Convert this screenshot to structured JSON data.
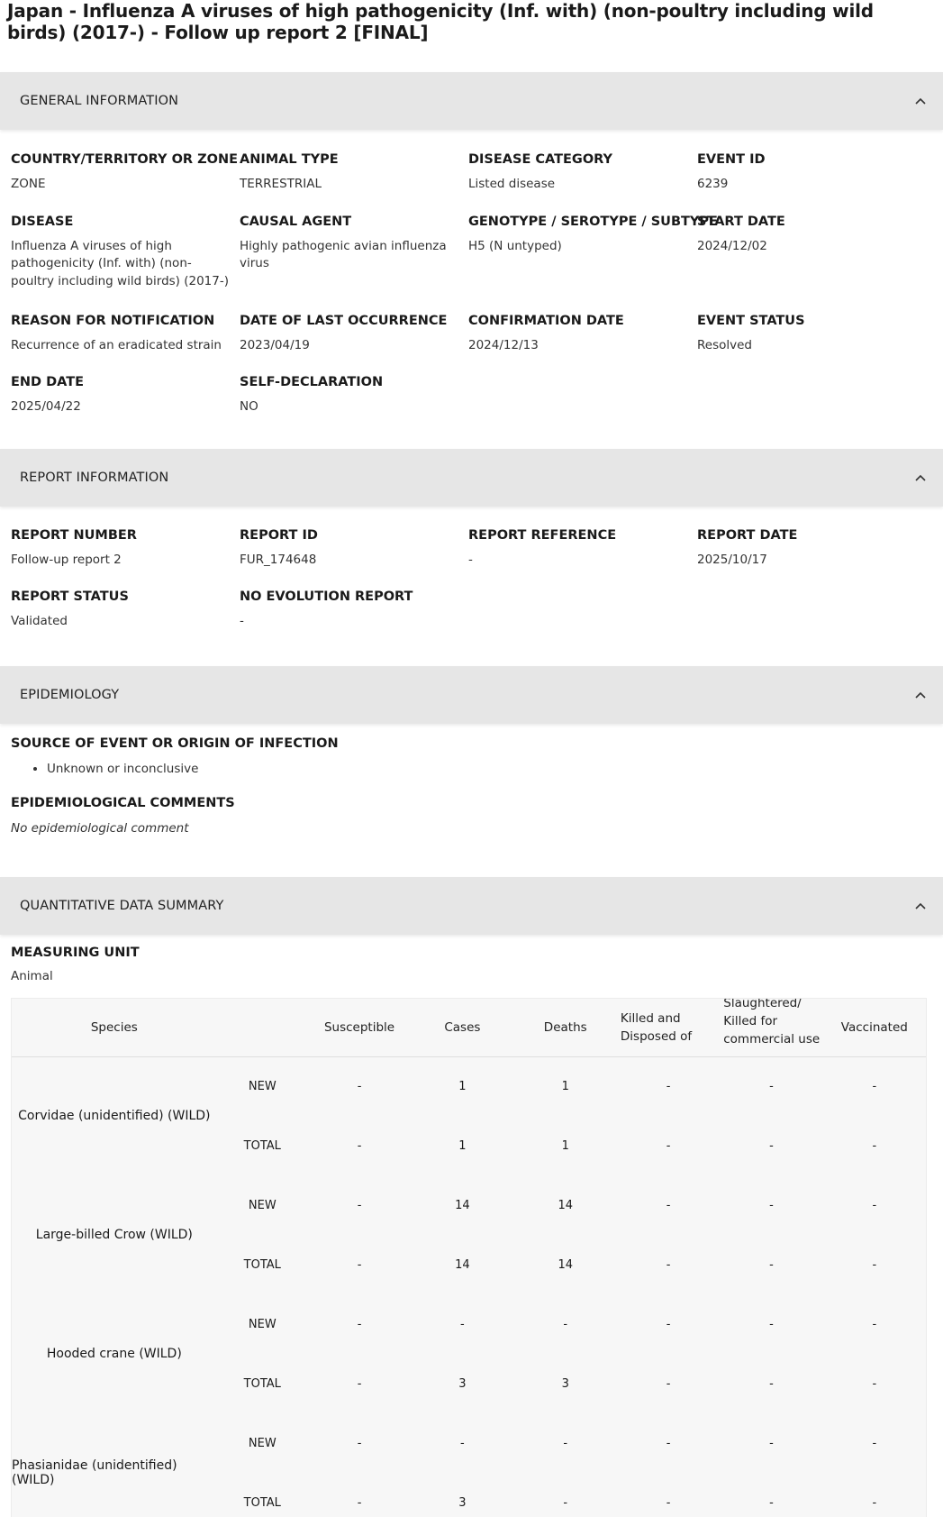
{
  "title": "Japan - Influenza A viruses of high pathogenicity (Inf. with) (non-poultry including wild birds) (2017-) - Follow up report 2 [FINAL]",
  "sections": {
    "general": {
      "label": "GENERAL INFORMATION"
    },
    "report": {
      "label": "REPORT INFORMATION"
    },
    "epi": {
      "label": "EPIDEMIOLOGY"
    },
    "quant": {
      "label": "QUANTITATIVE DATA SUMMARY"
    }
  },
  "general": {
    "country": {
      "k": "COUNTRY/TERRITORY OR ZONE",
      "v": "ZONE"
    },
    "animal_type": {
      "k": "ANIMAL TYPE",
      "v": "TERRESTRIAL"
    },
    "disease_category": {
      "k": "DISEASE CATEGORY",
      "v": "Listed disease"
    },
    "event_id": {
      "k": "EVENT ID",
      "v": "6239"
    },
    "disease": {
      "k": "DISEASE",
      "v": "Influenza A viruses of high pathogenicity (Inf. with) (non-poultry including wild birds) (2017-)"
    },
    "causal_agent": {
      "k": "CAUSAL AGENT",
      "v": "Highly pathogenic avian influenza virus"
    },
    "genotype": {
      "k": "GENOTYPE / SEROTYPE / SUBTYPE",
      "v": "H5 (N untyped)"
    },
    "start_date": {
      "k": "START DATE",
      "v": "2024/12/02"
    },
    "reason": {
      "k": "REASON FOR NOTIFICATION",
      "v": "Recurrence of an eradicated strain"
    },
    "last_occurrence": {
      "k": "DATE OF LAST OCCURRENCE",
      "v": "2023/04/19"
    },
    "confirmation": {
      "k": "CONFIRMATION DATE",
      "v": "2024/12/13"
    },
    "event_status": {
      "k": "EVENT STATUS",
      "v": "Resolved"
    },
    "end_date": {
      "k": "END DATE",
      "v": "2025/04/22"
    },
    "self_declaration": {
      "k": "SELF-DECLARATION",
      "v": "NO"
    }
  },
  "report": {
    "number": {
      "k": "REPORT NUMBER",
      "v": "Follow-up report 2"
    },
    "id": {
      "k": "REPORT ID",
      "v": "FUR_174648"
    },
    "reference": {
      "k": "REPORT REFERENCE",
      "v": "-"
    },
    "date": {
      "k": "REPORT DATE",
      "v": "2025/10/17"
    },
    "status": {
      "k": "REPORT STATUS",
      "v": "Validated"
    },
    "no_evolution": {
      "k": "NO EVOLUTION REPORT",
      "v": "-"
    }
  },
  "epi": {
    "source": {
      "k": "SOURCE OF EVENT OR ORIGIN OF INFECTION",
      "items": [
        "Unknown or inconclusive"
      ]
    },
    "comments": {
      "k": "EPIDEMIOLOGICAL COMMENTS",
      "v": "No epidemiological comment"
    }
  },
  "quant": {
    "measuring_unit": {
      "k": "MEASURING UNIT",
      "v": "Animal"
    },
    "columns": [
      "Species",
      "",
      "Susceptible",
      "Cases",
      "Deaths",
      "Killed and Disposed of",
      "Slaughtered/ Killed for commercial use",
      "Vaccinated"
    ],
    "rows": [
      {
        "species": "Corvidae (unidentified) (WILD)",
        "new": [
          "-",
          "1",
          "1",
          "-",
          "-",
          "-"
        ],
        "total": [
          "-",
          "1",
          "1",
          "-",
          "-",
          "-"
        ]
      },
      {
        "species": "Large-billed Crow (WILD)",
        "new": [
          "-",
          "14",
          "14",
          "-",
          "-",
          "-"
        ],
        "total": [
          "-",
          "14",
          "14",
          "-",
          "-",
          "-"
        ]
      },
      {
        "species": "Hooded crane (WILD)",
        "new": [
          "-",
          "-",
          "-",
          "-",
          "-",
          "-"
        ],
        "total": [
          "-",
          "3",
          "3",
          "-",
          "-",
          "-"
        ]
      },
      {
        "species": "Phasianidae (unidentified) (WILD)",
        "new": [
          "-",
          "-",
          "-",
          "-",
          "-",
          "-"
        ],
        "total": [
          "-",
          "3",
          "-",
          "-",
          "-",
          "-"
        ]
      }
    ],
    "row_labels": {
      "new": "NEW",
      "total": "TOTAL"
    }
  }
}
